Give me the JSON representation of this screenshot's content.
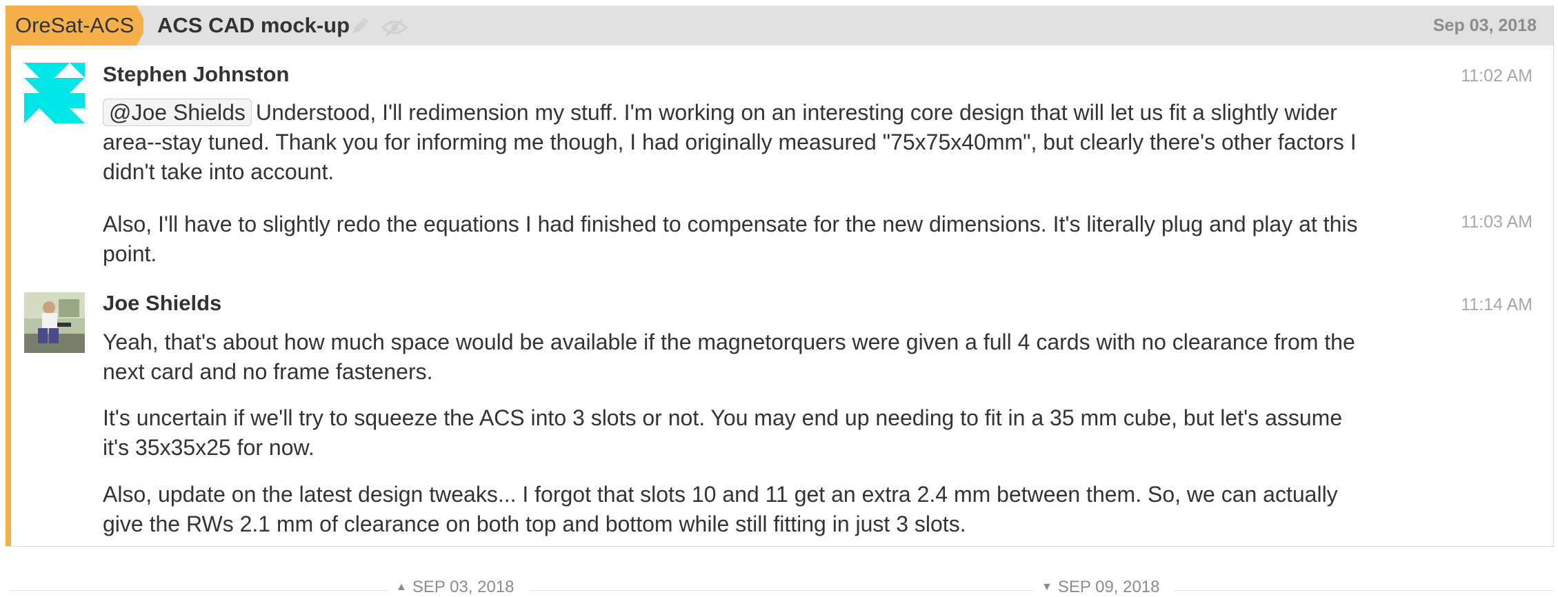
{
  "header": {
    "stream": "OreSat-ACS",
    "topic": "ACS CAD mock-up",
    "date": "Sep 03, 2018",
    "edit_icon": "pencil-icon",
    "mute_icon": "eye-slash-icon"
  },
  "messages": [
    {
      "sender": "Stephen Johnston",
      "avatar": "identicon-avatar",
      "time": "11:02 AM",
      "mention": "@Joe Shields",
      "text": "Understood, I'll redimension my stuff. I'm working on an interesting core design that will let us fit a slightly wider area--stay tuned. Thank you for informing me though, I had originally measured \"75x75x40mm\", but clearly there's other factors I didn't take into account."
    },
    {
      "sender": "Stephen Johnston",
      "time": "11:03 AM",
      "text": "Also, I'll have to slightly redo the equations I had finished to compensate for the new dimensions. It's literally plug and play at this point."
    },
    {
      "sender": "Joe Shields",
      "avatar": "photo-avatar",
      "time": "11:14 AM",
      "paragraphs": [
        "Yeah, that's about how much space would be available if the magnetorquers were given a full 4 cards with no clearance from the next card and no frame fasteners.",
        "It's uncertain if we'll try to squeeze the ACS into 3 slots or not. You may end up needing to fit in a 35 mm cube, but let's assume it's 35x35x25 for now.",
        "Also, update on the latest design tweaks... I forgot that slots 10 and 11 get an extra 2.4 mm between them. So, we can actually give the RWs 2.1 mm of clearance on both top and bottom while still fitting in just 3 slots."
      ]
    }
  ],
  "date_nav": {
    "prev": "SEP 03, 2018",
    "next": "SEP 09, 2018"
  },
  "colors": {
    "stream": "#f5b04c",
    "header_bg": "#e1e1e1",
    "identicon": "#00e5e5"
  }
}
